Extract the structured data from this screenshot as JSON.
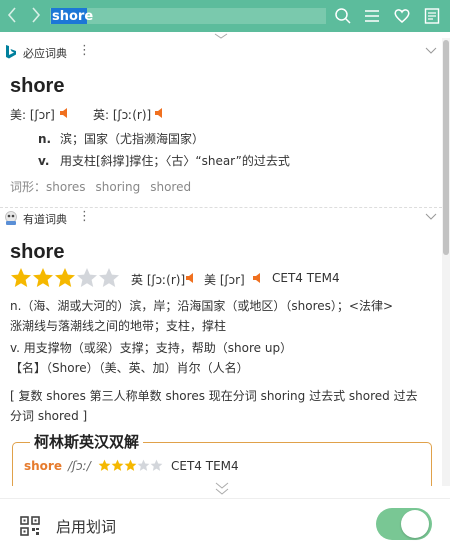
{
  "toolbar": {
    "back_glyph": "<",
    "forward_glyph": ">",
    "search_value": "shore",
    "icons": [
      "search-icon",
      "menu-icon",
      "heart-icon",
      "reader-icon"
    ]
  },
  "bing": {
    "source_name": "必应词典",
    "more_glyph": "⋮",
    "word": "shore",
    "pron_us": "美: [ʃɔr]",
    "pron_uk": "英: [ʃɔː(r)]",
    "definitions": [
      {
        "pos": "n.",
        "text": "滨；国家（尤指濒海国家）"
      },
      {
        "pos": "v.",
        "text": "用支柱[斜撑]撑住；〈古〉“shear”的过去式"
      }
    ],
    "forms_label": "词形：",
    "forms": [
      "shores",
      "shoring",
      "shored"
    ]
  },
  "youdao": {
    "source_name": "有道词典",
    "more_glyph": "⋮",
    "word": "shore",
    "star_rating": 3,
    "star_total": 5,
    "pron_uk": "英 [ʃɔː(r)]",
    "pron_us": "美 [ʃɔr]",
    "levels": "CET4 TEM4",
    "def_n_line1": "n.（海、湖或大河的）滨，岸；沿海国家（或地区）（shores）；<法律>",
    "def_n_line2": "涨潮线与落潮线之间的地带；支柱，撑柱",
    "def_v": "v. 用支撑物（或梁）支撑；支持，帮助（shore up）",
    "def_name": "【名】（Shore）（美、英、加）肖尔（人名）",
    "forms_line1": "[ 复数 shores 第三人称单数 shores 现在分词 shoring 过去式 shored 过去",
    "forms_line2": "分词 shored ]"
  },
  "collins": {
    "title": "柯林斯英汉双解",
    "word": "shore",
    "phonetic": "/ʃɔː/",
    "star_rating": 3,
    "star_total": 5,
    "levels": "CET4 TEM4"
  },
  "bottom": {
    "label": "启用划词",
    "toggle_on": true
  },
  "colors": {
    "accent": "#5cbc9c",
    "star_filled": "#f5b800",
    "star_empty": "#d3d6db",
    "speaker": "#f0701f",
    "collins_word": "#e67b2d",
    "toggle": "#79c794"
  }
}
